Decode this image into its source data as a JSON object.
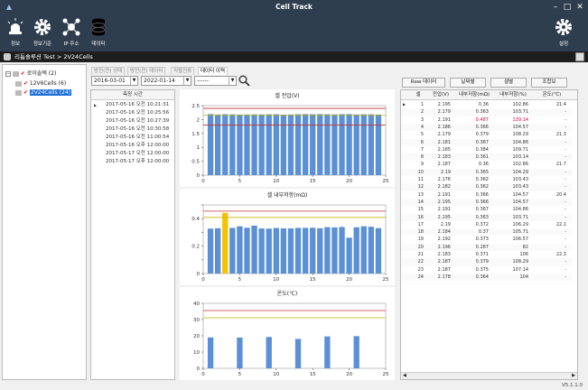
{
  "window": {
    "title": "Cell Track"
  },
  "ribbon": [
    {
      "label": "정보",
      "icon": "alarm-light-icon"
    },
    {
      "label": "정보기준",
      "icon": "gear-icon"
    },
    {
      "label": "IP 주소",
      "icon": "network-icon"
    },
    {
      "label": "데이터",
      "icon": "database-icon"
    }
  ],
  "ribbon_right": {
    "label": "설정",
    "icon": "gear-icon"
  },
  "breadcrumb": "리튬솔루션 Test > 2V24Cells",
  "tree": {
    "root": "로이솔텍 (2)",
    "children": [
      {
        "label": "12V6Cells (6)",
        "selected": false
      },
      {
        "label": "2V24Cells (24)",
        "selected": true
      }
    ]
  },
  "tabs": [
    "방전(전) 상태",
    "방전(전) 데이터",
    "직렬전류",
    "데이터 이력"
  ],
  "active_tab": "데이터 이력",
  "filters": {
    "start_date": "2016-03-01",
    "end_date": "2022-01-14",
    "third": "------"
  },
  "time_list": {
    "header": "측정 시간",
    "items": [
      "2017-05-16 오전 10:21:31",
      "2017-05-16 오전 10:25:56",
      "2017-05-16 오전 10:27:39",
      "2017-05-16 오전 10:30:58",
      "2017-05-16 오전 11:00:54",
      "2017-05-16 오후 12:00:00",
      "2017-05-17 오전 12:00:00",
      "2017-05-17 오후 12:00:00"
    ]
  },
  "buttons": [
    "Raw 데이터",
    "날짜별",
    "셀별",
    "조합보"
  ],
  "table": {
    "columns": [
      "셀",
      "전압(V)",
      "내부저항(mΩ)",
      "내부저항(%)",
      "온도(℃)"
    ],
    "rows": [
      [
        "1",
        "2.195",
        "0.36",
        "102.86",
        "21.4"
      ],
      [
        "2",
        "2.179",
        "0.363",
        "103.71",
        "-"
      ],
      [
        "3",
        "2.191",
        "0.487",
        "139.14",
        "-"
      ],
      [
        "4",
        "2.186",
        "0.366",
        "104.57",
        "-"
      ],
      [
        "5",
        "2.179",
        "0.379",
        "108.29",
        "21.3"
      ],
      [
        "6",
        "2.181",
        "0.367",
        "104.86",
        "-"
      ],
      [
        "7",
        "2.185",
        "0.384",
        "109.71",
        "-"
      ],
      [
        "8",
        "2.183",
        "0.361",
        "103.14",
        "-"
      ],
      [
        "9",
        "2.187",
        "0.36",
        "102.86",
        "21.7"
      ],
      [
        "10",
        "2.19",
        "0.365",
        "104.29",
        "-"
      ],
      [
        "11",
        "2.176",
        "0.362",
        "103.43",
        "-"
      ],
      [
        "12",
        "2.182",
        "0.362",
        "103.43",
        "-"
      ],
      [
        "13",
        "2.191",
        "0.366",
        "104.57",
        "20.4"
      ],
      [
        "14",
        "2.195",
        "0.366",
        "104.57",
        "-"
      ],
      [
        "15",
        "2.191",
        "0.367",
        "104.86",
        "-"
      ],
      [
        "16",
        "2.195",
        "0.363",
        "103.71",
        "-"
      ],
      [
        "17",
        "2.19",
        "0.372",
        "106.29",
        "22.1"
      ],
      [
        "18",
        "2.184",
        "0.37",
        "105.71",
        "-"
      ],
      [
        "19",
        "2.192",
        "0.373",
        "106.57",
        "-"
      ],
      [
        "20",
        "2.196",
        "0.287",
        "82",
        "-"
      ],
      [
        "21",
        "2.183",
        "0.371",
        "106",
        "22.3"
      ],
      [
        "22",
        "2.187",
        "0.379",
        "108.29",
        "-"
      ],
      [
        "23",
        "2.187",
        "0.375",
        "107.14",
        "-"
      ],
      [
        "24",
        "2.178",
        "0.364",
        "104",
        "-"
      ]
    ],
    "highlight_row": 2,
    "highlight_color": "#e0003c"
  },
  "version": "V5.1.1.0",
  "chart_data": [
    {
      "type": "bar",
      "title": "셀 전압(V)",
      "x": [
        1,
        2,
        3,
        4,
        5,
        6,
        7,
        8,
        9,
        10,
        11,
        12,
        13,
        14,
        15,
        16,
        17,
        18,
        19,
        20,
        21,
        22,
        23,
        24
      ],
      "values": [
        2.195,
        2.179,
        2.191,
        2.186,
        2.179,
        2.181,
        2.185,
        2.183,
        2.187,
        2.19,
        2.176,
        2.182,
        2.191,
        2.195,
        2.191,
        2.195,
        2.19,
        2.184,
        2.192,
        2.196,
        2.183,
        2.187,
        2.187,
        2.178
      ],
      "ylim": [
        0,
        2.5
      ],
      "yticks": [
        "0",
        "0.5",
        "1",
        "1.5",
        "2",
        "2.5"
      ],
      "xlim": [
        0,
        25
      ],
      "xticks": [
        "0",
        "5",
        "10",
        "15",
        "20",
        "25"
      ],
      "ref_lines": [
        {
          "y": 2.4,
          "color": "#c83232"
        },
        {
          "y": 2.15,
          "color": "#c8b400"
        },
        {
          "y": 1.8,
          "color": "#c83232"
        }
      ],
      "bar_color": "#5b8fd6",
      "highlight": null
    },
    {
      "type": "bar",
      "title": "셀 내부저항(mΩ)",
      "x": [
        1,
        2,
        3,
        4,
        5,
        6,
        7,
        8,
        9,
        10,
        11,
        12,
        13,
        14,
        15,
        16,
        17,
        18,
        19,
        20,
        21,
        22,
        23,
        24
      ],
      "values": [
        0.36,
        0.363,
        0.487,
        0.366,
        0.379,
        0.367,
        0.384,
        0.361,
        0.36,
        0.365,
        0.362,
        0.362,
        0.366,
        0.366,
        0.367,
        0.363,
        0.372,
        0.37,
        0.373,
        0.287,
        0.371,
        0.379,
        0.375,
        0.364
      ],
      "ylim": [
        0,
        0.55
      ],
      "yticks": [
        "0",
        "",
        "0.2",
        "",
        "0.4",
        ""
      ],
      "xlim": [
        0,
        25
      ],
      "xticks": [
        "0",
        "5",
        "10",
        "15",
        "20",
        "25"
      ],
      "ref_lines": [
        {
          "y": 0.5,
          "color": "#c83232"
        },
        {
          "y": 0.45,
          "color": "#c8b400"
        }
      ],
      "bar_color": "#5b8fd6",
      "highlight": {
        "index": 2,
        "color": "#f5c400"
      }
    },
    {
      "type": "bar",
      "title": "온도(℃)",
      "x": [
        1,
        5,
        9,
        13,
        17,
        21
      ],
      "values": [
        21.4,
        21.3,
        21.7,
        20.4,
        22.1,
        22.3
      ],
      "ylim": [
        0,
        45
      ],
      "yticks": [
        "0",
        "10",
        "20",
        "30",
        "40"
      ],
      "xlim": [
        0,
        25
      ],
      "xticks": [
        "0",
        "5",
        "10",
        "15",
        "20",
        "25"
      ],
      "ref_lines": [
        {
          "y": 40,
          "color": "#c83232"
        },
        {
          "y": 35,
          "color": "#c8b400"
        }
      ],
      "bar_color": "#5b8fd6",
      "highlight": null
    }
  ]
}
